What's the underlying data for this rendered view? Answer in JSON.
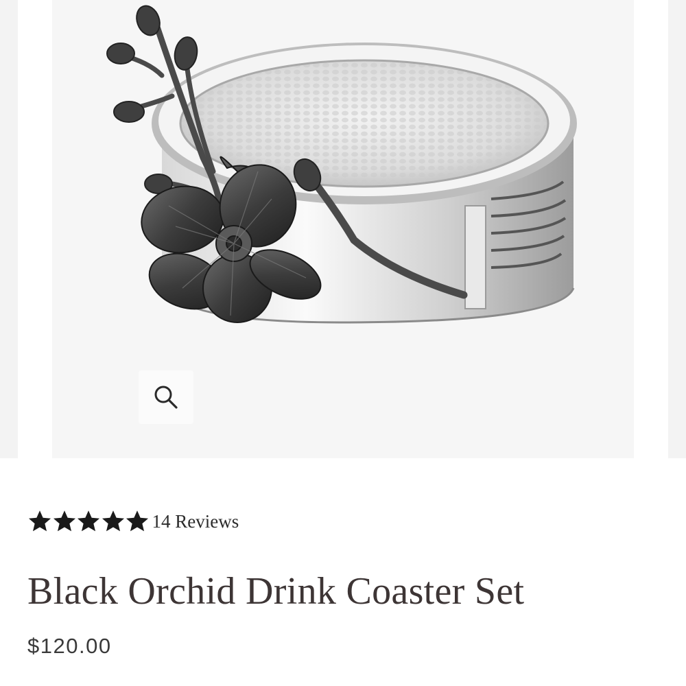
{
  "gallery": {
    "image_alt": "Black Orchid Drink Coaster Set",
    "zoom_icon": "magnifier-icon"
  },
  "product": {
    "rating_stars": 5,
    "rating_icon": "star-icon",
    "review_count_label": "14 Reviews",
    "title": "Black Orchid Drink Coaster Set",
    "price": "$120.00"
  },
  "colors": {
    "star": "#1a1a1a",
    "title": "#3d3535",
    "image_background": "#f6f6f6"
  }
}
